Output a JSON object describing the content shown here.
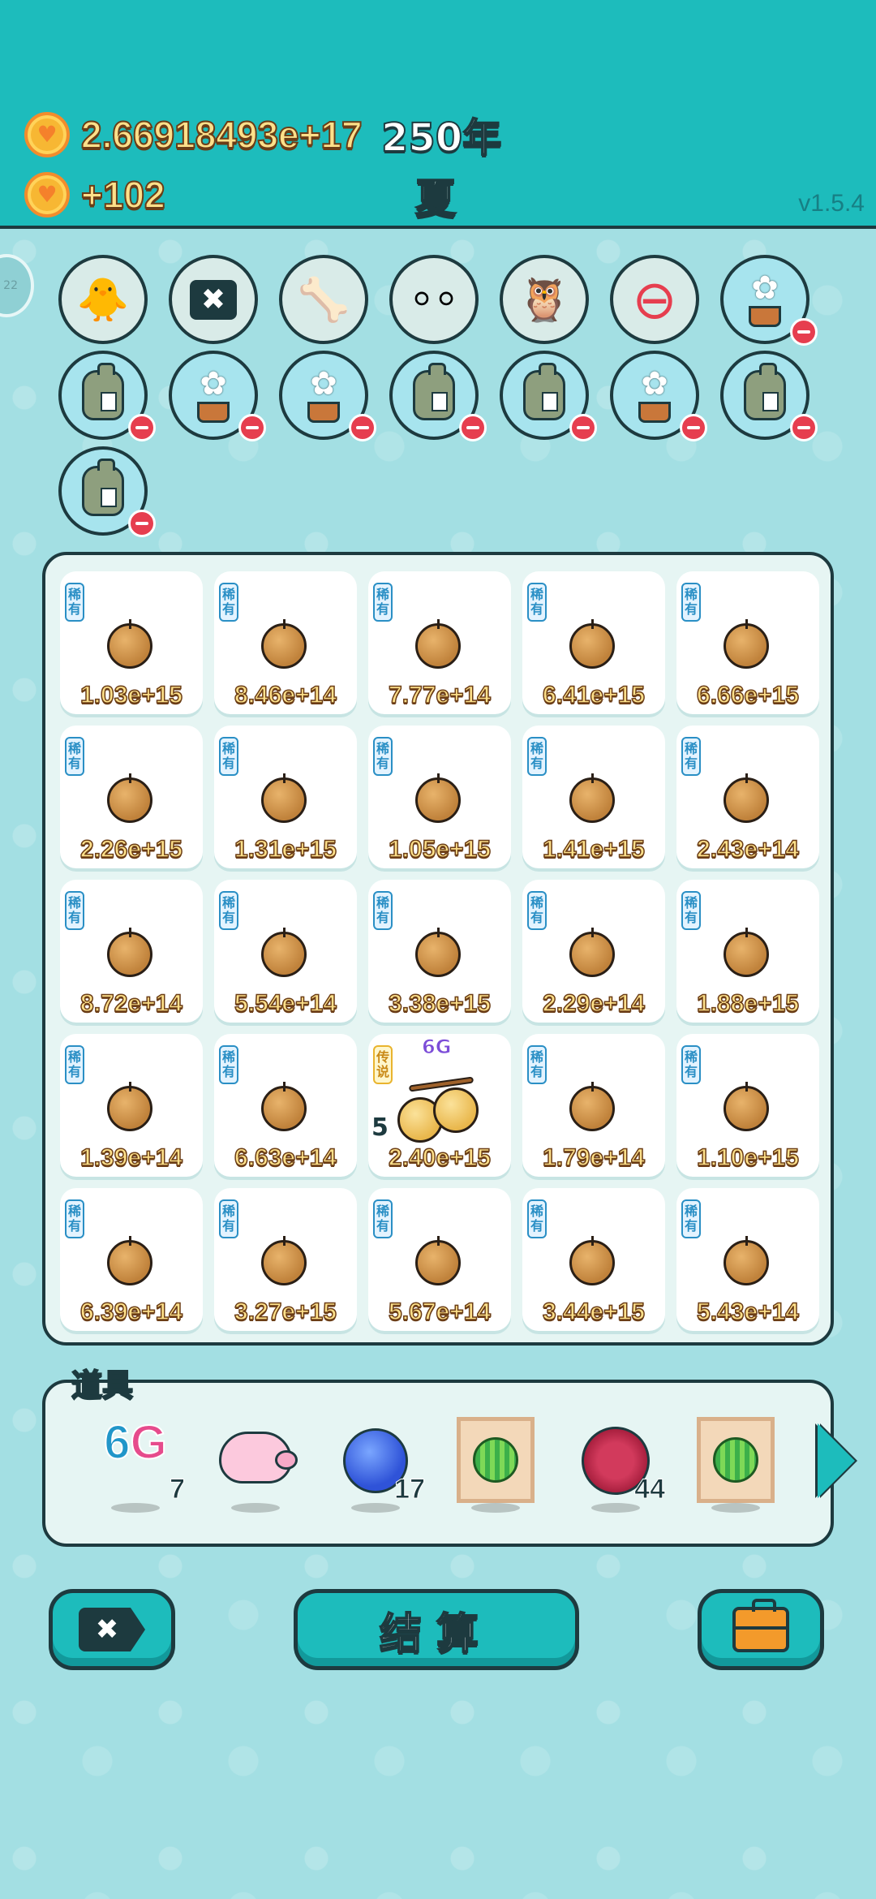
{
  "header": {
    "coins": "2.66918493e+17",
    "year": "250年",
    "income": "+102",
    "season": "夏",
    "version": "v1.5.4"
  },
  "side_tab": {
    "label": "22"
  },
  "icons": {
    "coin": "heart-coin-icon",
    "tag_rare": "稀有",
    "tag_legend": "传说"
  },
  "grid": {
    "rows": [
      [
        {
          "tag": "稀有",
          "value": "1.03e+15"
        },
        {
          "tag": "稀有",
          "value": "8.46e+14"
        },
        {
          "tag": "稀有",
          "value": "7.77e+14"
        },
        {
          "tag": "稀有",
          "value": "6.41e+15"
        },
        {
          "tag": "稀有",
          "value": "6.66e+15"
        }
      ],
      [
        {
          "tag": "稀有",
          "value": "2.26e+15"
        },
        {
          "tag": "稀有",
          "value": "1.31e+15"
        },
        {
          "tag": "稀有",
          "value": "1.05e+15"
        },
        {
          "tag": "稀有",
          "value": "1.41e+15"
        },
        {
          "tag": "稀有",
          "value": "2.43e+14"
        }
      ],
      [
        {
          "tag": "稀有",
          "value": "8.72e+14"
        },
        {
          "tag": "稀有",
          "value": "5.54e+14"
        },
        {
          "tag": "稀有",
          "value": "3.38e+15"
        },
        {
          "tag": "稀有",
          "value": "2.29e+14"
        },
        {
          "tag": "稀有",
          "value": "1.88e+15"
        }
      ],
      [
        {
          "tag": "稀有",
          "value": "1.39e+14"
        },
        {
          "tag": "稀有",
          "value": "6.63e+14"
        },
        {
          "tag": "传说",
          "value": "2.40e+15",
          "badge_top": "6G",
          "badge_left": "5"
        },
        {
          "tag": "稀有",
          "value": "1.79e+14"
        },
        {
          "tag": "稀有",
          "value": "1.10e+15"
        }
      ],
      [
        {
          "tag": "稀有",
          "value": "6.39e+14"
        },
        {
          "tag": "稀有",
          "value": "3.27e+15"
        },
        {
          "tag": "稀有",
          "value": "5.67e+14"
        },
        {
          "tag": "稀有",
          "value": "3.44e+15"
        },
        {
          "tag": "稀有",
          "value": "5.43e+14"
        }
      ]
    ]
  },
  "tools": {
    "label": "道具",
    "items": [
      {
        "name": "6g-icon",
        "text_a": "6",
        "text_b": "G",
        "count": "7"
      },
      {
        "name": "piggy-bank-icon",
        "count": ""
      },
      {
        "name": "blueberry-icon",
        "count": "17"
      },
      {
        "name": "melon-painting-icon",
        "count": ""
      },
      {
        "name": "lychee-icon",
        "count": "44"
      },
      {
        "name": "melon-painting-icon",
        "count": ""
      }
    ]
  },
  "buttons": {
    "close_symbol": "✖",
    "settle": "结算"
  }
}
